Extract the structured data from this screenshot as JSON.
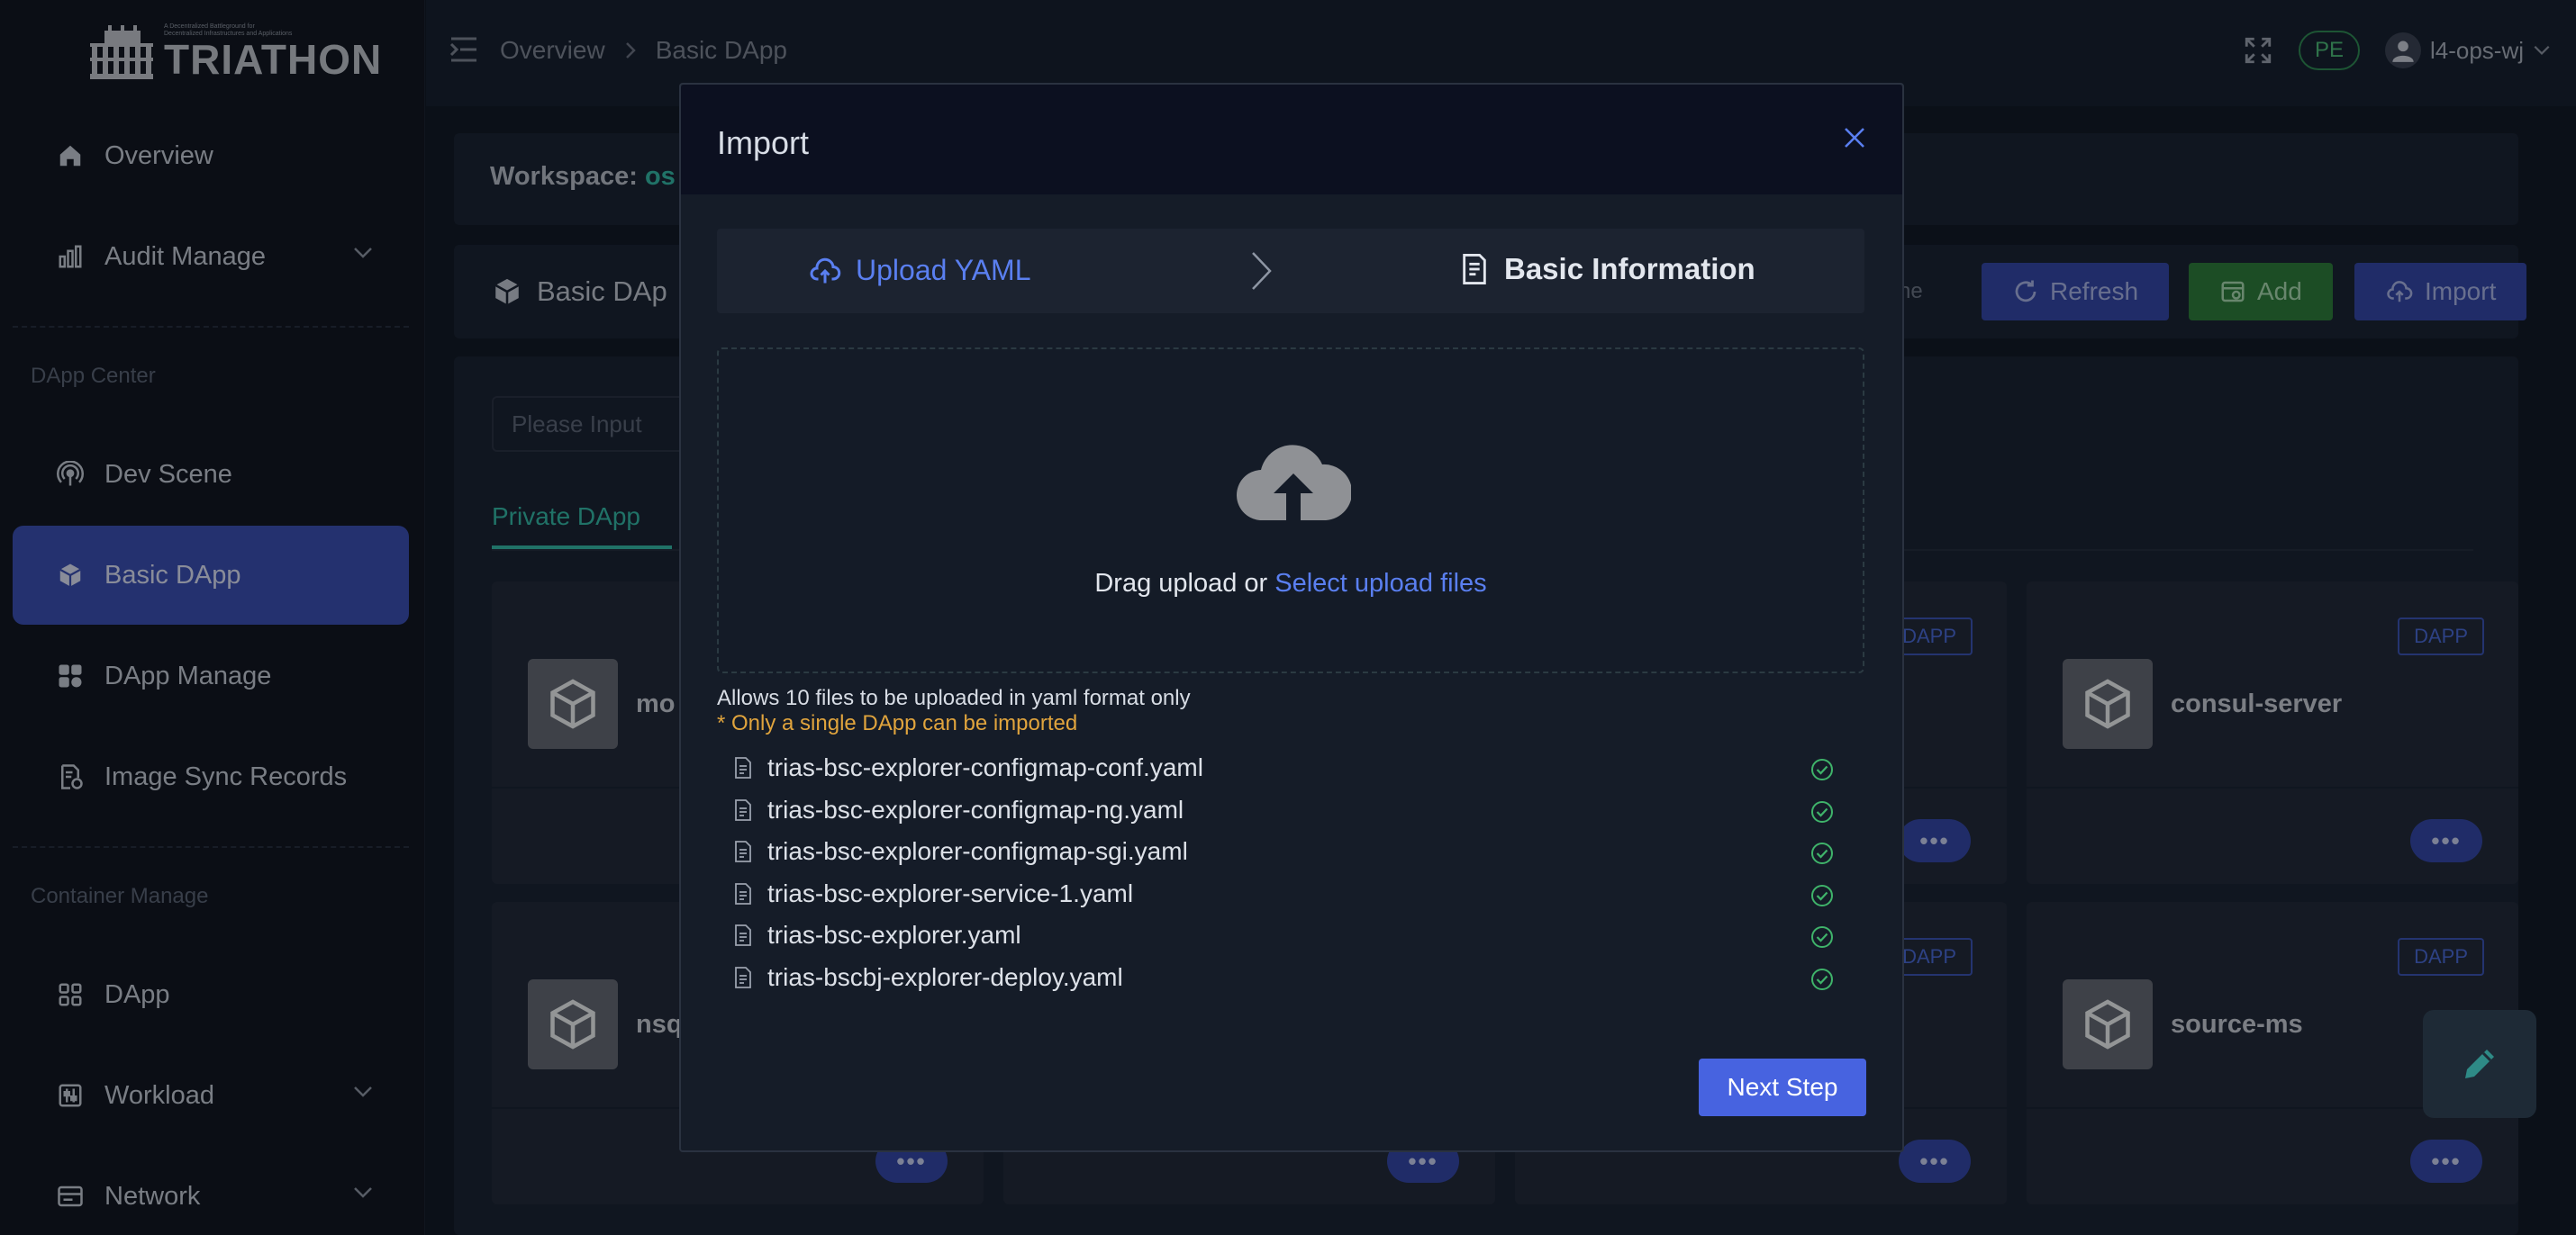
{
  "brand": {
    "tagline_line1": "A Decentralized Battleground for",
    "tagline_line2": "Decentralized Infrastructures and Applications",
    "wordmark": "TRIATHON"
  },
  "sidebar": {
    "items": [
      {
        "label": "Overview",
        "icon": "home-icon"
      },
      {
        "label": "Audit Manage",
        "icon": "bar-chart-icon"
      },
      {
        "label": "Dev Scene",
        "icon": "broadcast-icon"
      },
      {
        "label": "Basic DApp",
        "icon": "cube-icon"
      },
      {
        "label": "DApp Manage",
        "icon": "apps-icon"
      },
      {
        "label": "Image Sync Records",
        "icon": "sync-records-icon"
      },
      {
        "label": "DApp",
        "icon": "grid-icon"
      },
      {
        "label": "Workload",
        "icon": "sliders-icon"
      },
      {
        "label": "Network",
        "icon": "network-icon"
      }
    ],
    "sections": {
      "dapp_center": "DApp Center",
      "container_manage": "Container Manage"
    }
  },
  "header": {
    "breadcrumb": [
      "Overview",
      "Basic DApp"
    ],
    "badge": "PE",
    "username": "l4-ops-wj"
  },
  "main": {
    "workspace_label": "Workspace:",
    "workspace_value": "os",
    "page_title": "Basic DAp",
    "hint_fragment": "he",
    "buttons": {
      "refresh": "Refresh",
      "add": "Add",
      "import": "Import"
    },
    "search_placeholder": "Please Input",
    "tab_private": "Private DApp",
    "cards": [
      {
        "name": "mo",
        "tag": ""
      },
      {
        "name": "",
        "tag": "DAPP"
      },
      {
        "name": "consul-server",
        "tag": "DAPP"
      },
      {
        "name": "nsq",
        "tag": ""
      },
      {
        "name": "",
        "tag": "DAPP"
      },
      {
        "name": "source-ms",
        "tag": "DAPP"
      }
    ],
    "more_label": "•••"
  },
  "modal": {
    "title": "Import",
    "steps": {
      "step1": "Upload YAML",
      "step2": "Basic Information"
    },
    "dropzone": {
      "text": "Drag upload or ",
      "link": "Select upload files"
    },
    "hint_formats": "Allows 10 files to be uploaded in yaml format only",
    "hint_single": "* Only a single DApp can be imported",
    "files": [
      "trias-bsc-explorer-configmap-conf.yaml",
      "trias-bsc-explorer-configmap-ng.yaml",
      "trias-bsc-explorer-configmap-sgi.yaml",
      "trias-bsc-explorer-service-1.yaml",
      "trias-bsc-explorer.yaml",
      "trias-bscbj-explorer-deploy.yaml"
    ],
    "next_label": "Next Step"
  },
  "colors": {
    "accent": "#4763e0",
    "link": "#5a7ff0",
    "warning": "#e0a43d",
    "success": "#3fb36a",
    "teal": "#35b8a6"
  }
}
